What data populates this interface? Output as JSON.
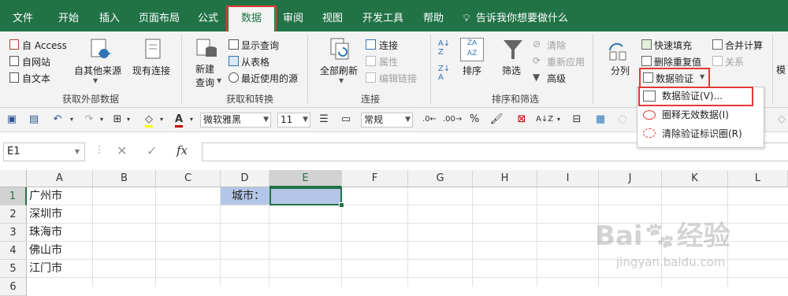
{
  "tabs": [
    "文件",
    "开始",
    "插入",
    "页面布局",
    "公式",
    "数据",
    "审阅",
    "视图",
    "开发工具",
    "帮助"
  ],
  "tell_me": "告诉我你想要做什么",
  "ribbon": {
    "get_external": {
      "label": "获取外部数据",
      "access": "自 Access",
      "web": "自网站",
      "text": "自文本",
      "other": "自其他来源",
      "existing": "现有连接"
    },
    "get_transform": {
      "label": "获取和转换",
      "new_query_1": "新建",
      "new_query_2": "查询",
      "show_queries": "显示查询",
      "from_table": "从表格",
      "recent_sources": "最近使用的源"
    },
    "connections": {
      "label": "连接",
      "refresh_all": "全部刷新",
      "connections": "连接",
      "properties": "属性",
      "edit_links": "编辑链接"
    },
    "sort_filter": {
      "label": "排序和筛选",
      "sort": "排序",
      "filter": "筛选",
      "clear": "清除",
      "reapply": "重新应用",
      "advanced": "高级"
    },
    "data_tools": {
      "split": "分列",
      "flash_fill": "快速填充",
      "remove_dup": "删除重复值",
      "data_validation": "数据验证",
      "consolidate": "合并计算",
      "relations": "关系"
    }
  },
  "qat": {
    "font": "微软雅黑",
    "size": "11",
    "format": "常规"
  },
  "formula_bar": {
    "name_box": "E1",
    "fx": "fx"
  },
  "columns": [
    "A",
    "B",
    "C",
    "D",
    "E",
    "F",
    "G",
    "H",
    "I",
    "J",
    "K",
    "L"
  ],
  "rows": [
    "1",
    "2",
    "3",
    "4",
    "5",
    "6"
  ],
  "cells": {
    "A1": "广州市",
    "A2": "深圳市",
    "A3": "珠海市",
    "A4": "佛山市",
    "A5": "江门市",
    "D1": "城市："
  },
  "dropdown": {
    "items": [
      "数据验证(V)...",
      "圈释无效数据(I)",
      "清除验证标识圈(R)"
    ]
  },
  "watermark": {
    "brand": "Bai",
    "brand2": "经验",
    "url": "jingyan.baidu.com"
  },
  "colors": {
    "excel_green": "#217346",
    "highlight_red": "#e53935",
    "selected_cell": "#b4c6e7"
  }
}
